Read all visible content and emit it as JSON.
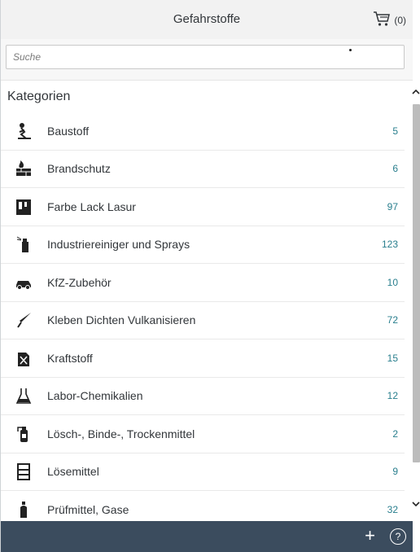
{
  "header": {
    "title": "Gefahrstoffe",
    "cart_count": "(0)"
  },
  "search": {
    "placeholder": "Suche"
  },
  "section": {
    "title": "Kategorien"
  },
  "categories": [
    {
      "label": "Baustoff",
      "count": "5",
      "icon": "construction-worker-icon"
    },
    {
      "label": "Brandschutz",
      "count": "6",
      "icon": "fire-wall-icon"
    },
    {
      "label": "Farbe Lack Lasur",
      "count": "97",
      "icon": "paint-can-icon"
    },
    {
      "label": "Industriereiniger und Sprays",
      "count": "123",
      "icon": "spray-can-icon"
    },
    {
      "label": "KfZ-Zubehör",
      "count": "10",
      "icon": "car-icon"
    },
    {
      "label": "Kleben Dichten Vulkanisieren",
      "count": "72",
      "icon": "glue-gun-icon"
    },
    {
      "label": "Kraftstoff",
      "count": "15",
      "icon": "fuel-canister-icon"
    },
    {
      "label": "Labor-Chemikalien",
      "count": "12",
      "icon": "lab-flask-icon"
    },
    {
      "label": "Lösch-, Binde-, Trockenmittel",
      "count": "2",
      "icon": "fire-extinguisher-icon"
    },
    {
      "label": "Lösemittel",
      "count": "9",
      "icon": "solvent-rack-icon"
    },
    {
      "label": "Prüfmittel, Gase",
      "count": "32",
      "icon": "gas-bottle-icon"
    }
  ],
  "footer": {
    "plus": "+",
    "help": "?"
  },
  "colors": {
    "footer": "#3b4c5e",
    "count": "#2a7f8e",
    "header": "#f2f2f2"
  }
}
